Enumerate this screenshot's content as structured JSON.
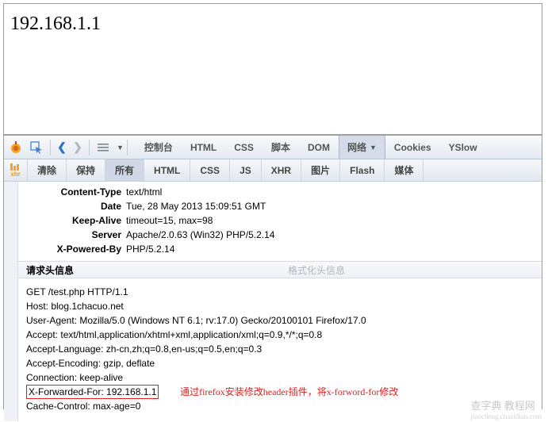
{
  "page": {
    "ip_text": "192.168.1.1"
  },
  "top_tabs": {
    "console": "控制台",
    "html": "HTML",
    "css": "CSS",
    "script": "脚本",
    "dom": "DOM",
    "net": "网络",
    "cookies": "Cookies",
    "yslow": "YSlow"
  },
  "sub_tabs": {
    "clear": "清除",
    "persist": "保持",
    "all": "所有",
    "html": "HTML",
    "css": "CSS",
    "js": "JS",
    "xhr": "XHR",
    "images": "图片",
    "flash": "Flash",
    "media": "媒体",
    "xhr_icon_label": "xhr"
  },
  "response_headers": {
    "content_type": {
      "label": "Content-Type",
      "value": "text/html"
    },
    "date": {
      "label": "Date",
      "value": "Tue, 28 May 2013 15:09:51 GMT"
    },
    "keep_alive": {
      "label": "Keep-Alive",
      "value": "timeout=15, max=98"
    },
    "server": {
      "label": "Server",
      "value": "Apache/2.0.63 (Win32) PHP/5.2.14"
    },
    "x_powered_by": {
      "label": "X-Powered-By",
      "value": "PHP/5.2.14"
    }
  },
  "section_tabs": {
    "request_headers": "请求头信息",
    "formatted_headers": "格式化头信息"
  },
  "request_raw": {
    "line1": "GET /test.php HTTP/1.1",
    "host": "Host: blog.1chacuo.net",
    "ua": "User-Agent: Mozilla/5.0 (Windows NT 6.1; rv:17.0) Gecko/20100101 Firefox/17.0",
    "accept": "Accept: text/html,application/xhtml+xml,application/xml;q=0.9,*/*;q=0.8",
    "accept_lang": "Accept-Language: zh-cn,zh;q=0.8,en-us;q=0.5,en;q=0.3",
    "accept_enc": "Accept-Encoding: gzip, deflate",
    "connection": "Connection: keep-alive",
    "xff": "X-Forwarded-For: 192.168.1.1",
    "cache_control": "Cache-Control: max-age=0"
  },
  "annotation": "通过firefox安装修改header插件，将x-forword-for修改",
  "watermark": {
    "line1": "查字典 教程网",
    "line2": "jiaocheng.chazidian.com"
  }
}
